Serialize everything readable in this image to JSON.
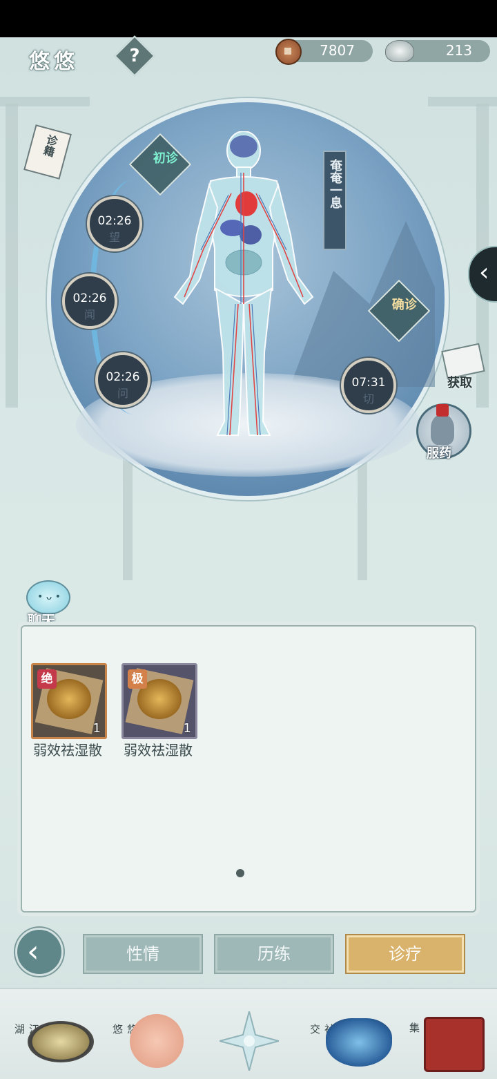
{
  "header": {
    "name": "悠悠",
    "help_icon": "?",
    "currencies": [
      {
        "icon": "copper-coin-icon",
        "value": "7807"
      },
      {
        "icon": "silver-ingot-icon",
        "value": "213"
      }
    ]
  },
  "diagnosis": {
    "initial_label": "初诊",
    "confirm_label": "确诊",
    "status_banner": "奄奄一息",
    "timers": [
      {
        "time": "02:26",
        "method": "望"
      },
      {
        "time": "02:26",
        "method": "闻"
      },
      {
        "time": "02:26",
        "method": "问"
      },
      {
        "time": "07:31",
        "method": "切"
      }
    ]
  },
  "side": {
    "book_label": "诊籍",
    "acquire_label": "获取",
    "take_medicine_label": "服药"
  },
  "chat": {
    "label": "聊天"
  },
  "inventory": {
    "items": [
      {
        "name": "弱效祛湿散",
        "grade": "绝",
        "grade_color": "#c43a4a",
        "qty": "1",
        "frame_color": "#c9844a"
      },
      {
        "name": "弱效祛湿散",
        "grade": "极",
        "grade_color": "#d4804a",
        "qty": "1",
        "frame_color": "#6e6c80"
      }
    ]
  },
  "tabs": [
    {
      "label": "性情",
      "active": false
    },
    {
      "label": "历练",
      "active": false
    },
    {
      "label": "诊疗",
      "active": true
    }
  ],
  "nav": [
    {
      "label": "江湖",
      "icon": "straw-hat-icon"
    },
    {
      "label": "悠悠",
      "icon": "swallow-icon"
    },
    {
      "label": "",
      "icon": "compass-star-icon"
    },
    {
      "label": "社交",
      "icon": "wave-bowl-icon"
    },
    {
      "label": "赶集",
      "icon": "market-basket-icon"
    }
  ]
}
